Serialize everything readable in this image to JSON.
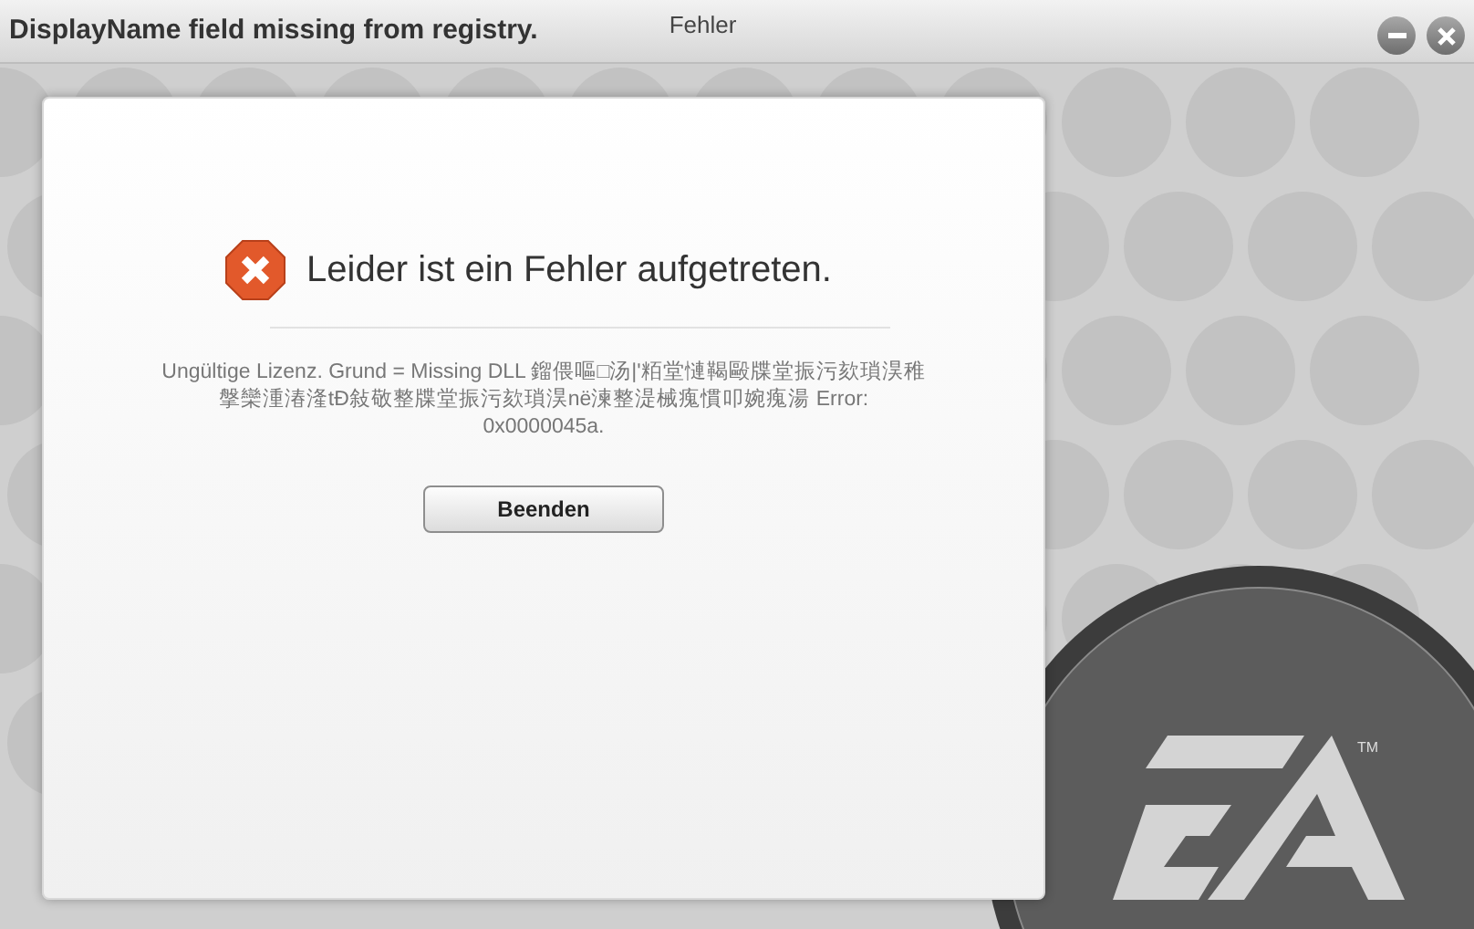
{
  "window": {
    "title": "DisplayName field missing from registry.",
    "subtitle": "Fehler"
  },
  "dialog": {
    "heading": "Leider ist ein Fehler aufgetreten.",
    "message": "Ungültige Lizenz. Grund = Missing DLL 鎦偎嘔□汤|'粨堂慩鞨毆牒堂振污欬瑣淏稚搫欒湩湷湰tÐ敍敬整牒堂振污欬瑣淏në湅整湜械瘣慣叩婉瘣湯   Error: 0x0000045a.",
    "button": "Beenden"
  },
  "logo": {
    "trademark": "TM"
  }
}
